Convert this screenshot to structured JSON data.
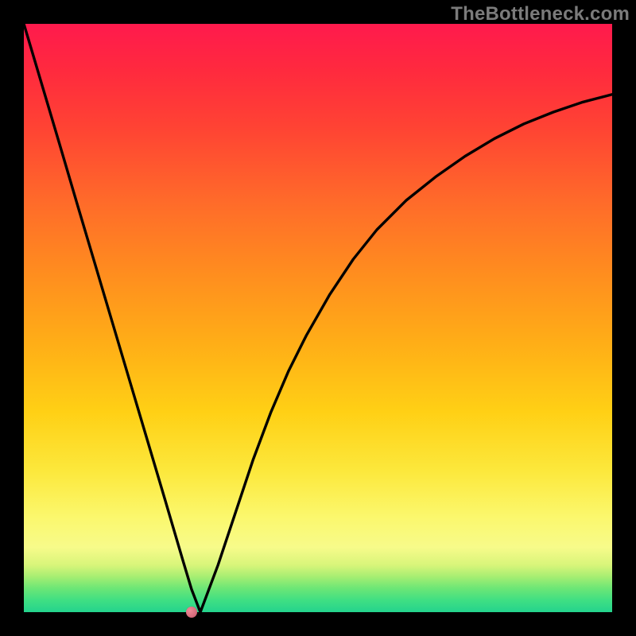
{
  "watermark": "TheBottleneck.com",
  "chart_data": {
    "type": "line",
    "title": "",
    "xlabel": "",
    "ylabel": "",
    "xlim": [
      0,
      100
    ],
    "ylim": [
      0,
      100
    ],
    "x": [
      0,
      3,
      6,
      9,
      12,
      15,
      18,
      21,
      24,
      27,
      28.5,
      30,
      33,
      36,
      39,
      42,
      45,
      48,
      52,
      56,
      60,
      65,
      70,
      75,
      80,
      85,
      90,
      95,
      100
    ],
    "values": [
      100,
      89.9,
      79.8,
      69.6,
      59.5,
      49.4,
      39.3,
      29.2,
      19.1,
      8.9,
      3.9,
      0,
      8,
      17,
      26,
      34,
      41,
      47,
      54,
      60,
      65,
      70,
      74,
      77.5,
      80.5,
      83,
      85,
      86.7,
      88
    ],
    "marker": {
      "x": 28.5,
      "y": 0
    },
    "background_gradient": {
      "top": "#ff1a4d",
      "mid": "#ffd015",
      "bottom": "#24d38d"
    }
  }
}
